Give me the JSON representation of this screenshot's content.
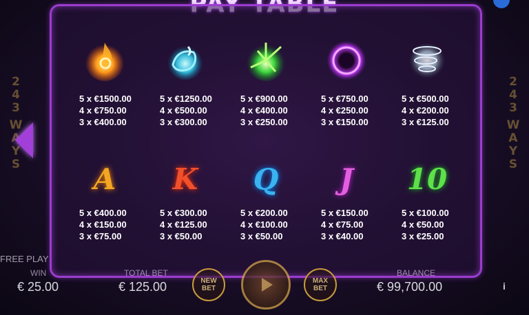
{
  "title": "PAY TABLE",
  "side_text": [
    "2",
    "4",
    "3",
    "W",
    "A",
    "Y",
    "S"
  ],
  "symbols_row1": [
    {
      "icon": "fire-swirl-icon",
      "pays": [
        "5 x €1500.00",
        "4 x €750.00",
        "3 x €400.00"
      ]
    },
    {
      "icon": "water-splash-icon",
      "pays": [
        "5 x €1250.00",
        "4 x €500.00",
        "3 x €300.00"
      ]
    },
    {
      "icon": "green-leaf-burst-icon",
      "pays": [
        "5 x €900.00",
        "4 x €400.00",
        "3 x €250.00"
      ]
    },
    {
      "icon": "purple-ring-icon",
      "pays": [
        "5 x €750.00",
        "4 x €250.00",
        "3 x €150.00"
      ]
    },
    {
      "icon": "wind-swirl-icon",
      "pays": [
        "5 x €500.00",
        "4 x €200.00",
        "3 x €125.00"
      ]
    }
  ],
  "symbols_row2": [
    {
      "letter": "A",
      "color": "#f2a623",
      "pays": [
        "5 x €400.00",
        "4 x €150.00",
        "3 x €75.00"
      ]
    },
    {
      "letter": "K",
      "color": "#f0502b",
      "pays": [
        "5 x €300.00",
        "4 x €125.00",
        "3 x €50.00"
      ]
    },
    {
      "letter": "Q",
      "color": "#3ab3f0",
      "pays": [
        "5 x €200.00",
        "4 x €100.00",
        "3 x €50.00"
      ]
    },
    {
      "letter": "J",
      "color": "#e45fe0",
      "pays": [
        "5 x €150.00",
        "4 x €75.00",
        "3 x €40.00"
      ]
    },
    {
      "letter": "10",
      "color": "#5fe04a",
      "pays": [
        "5 x €100.00",
        "4 x €50.00",
        "3 x €25.00"
      ]
    }
  ],
  "bottom": {
    "free_play": "FREE PLAY",
    "win_label": "WIN",
    "win_value": "€ 25.00",
    "total_bet_label": "TOTAL BET",
    "total_bet_value": "€ 125.00",
    "new_bet": "NEW BET",
    "max_bet": "MAX BET",
    "balance_label": "BALANCE",
    "balance_value": "€ 99,700.00",
    "info": "i"
  },
  "colors": {
    "accent": "#9b3ccf",
    "gold": "#c89b3c"
  }
}
